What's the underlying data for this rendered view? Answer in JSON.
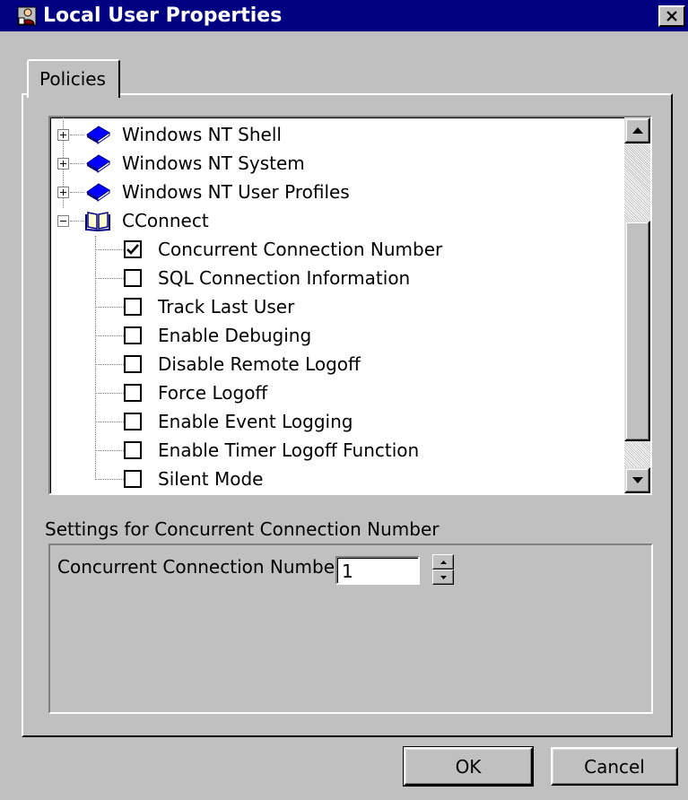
{
  "window": {
    "title": "Local User Properties",
    "icons": {
      "app": "user-properties-icon",
      "close": "close-icon"
    }
  },
  "tabs": [
    {
      "label": "Policies",
      "selected": true
    }
  ],
  "tree": {
    "nodes": [
      {
        "label": "Windows NT Shell",
        "type": "category",
        "expanded": false,
        "icon": "book-closed-icon"
      },
      {
        "label": "Windows NT System",
        "type": "category",
        "expanded": false,
        "icon": "book-closed-icon"
      },
      {
        "label": "Windows NT User Profiles",
        "type": "category",
        "expanded": false,
        "icon": "book-closed-icon"
      },
      {
        "label": "CConnect",
        "type": "category",
        "expanded": true,
        "icon": "book-open-icon"
      }
    ],
    "policies": [
      {
        "label": "Concurrent Connection Number",
        "checked": true
      },
      {
        "label": "SQL Connection Information",
        "checked": false
      },
      {
        "label": "Track Last User",
        "checked": false
      },
      {
        "label": "Enable Debuging",
        "checked": false
      },
      {
        "label": "Disable Remote Logoff",
        "checked": false
      },
      {
        "label": "Force Logoff",
        "checked": false
      },
      {
        "label": "Enable Event Logging",
        "checked": false
      },
      {
        "label": "Enable Timer Logoff Function",
        "checked": false
      },
      {
        "label": "Silent Mode",
        "checked": false
      }
    ]
  },
  "settings": {
    "group_label": "Settings for Concurrent Connection Number",
    "field_label": "Concurrent Connection Number",
    "field_value": "1"
  },
  "buttons": {
    "ok": "OK",
    "cancel": "Cancel"
  },
  "colors": {
    "title_bar": "#000080",
    "face": "#c0c0c0",
    "window": "#ffffff",
    "icon_blue": "#0000ff"
  }
}
